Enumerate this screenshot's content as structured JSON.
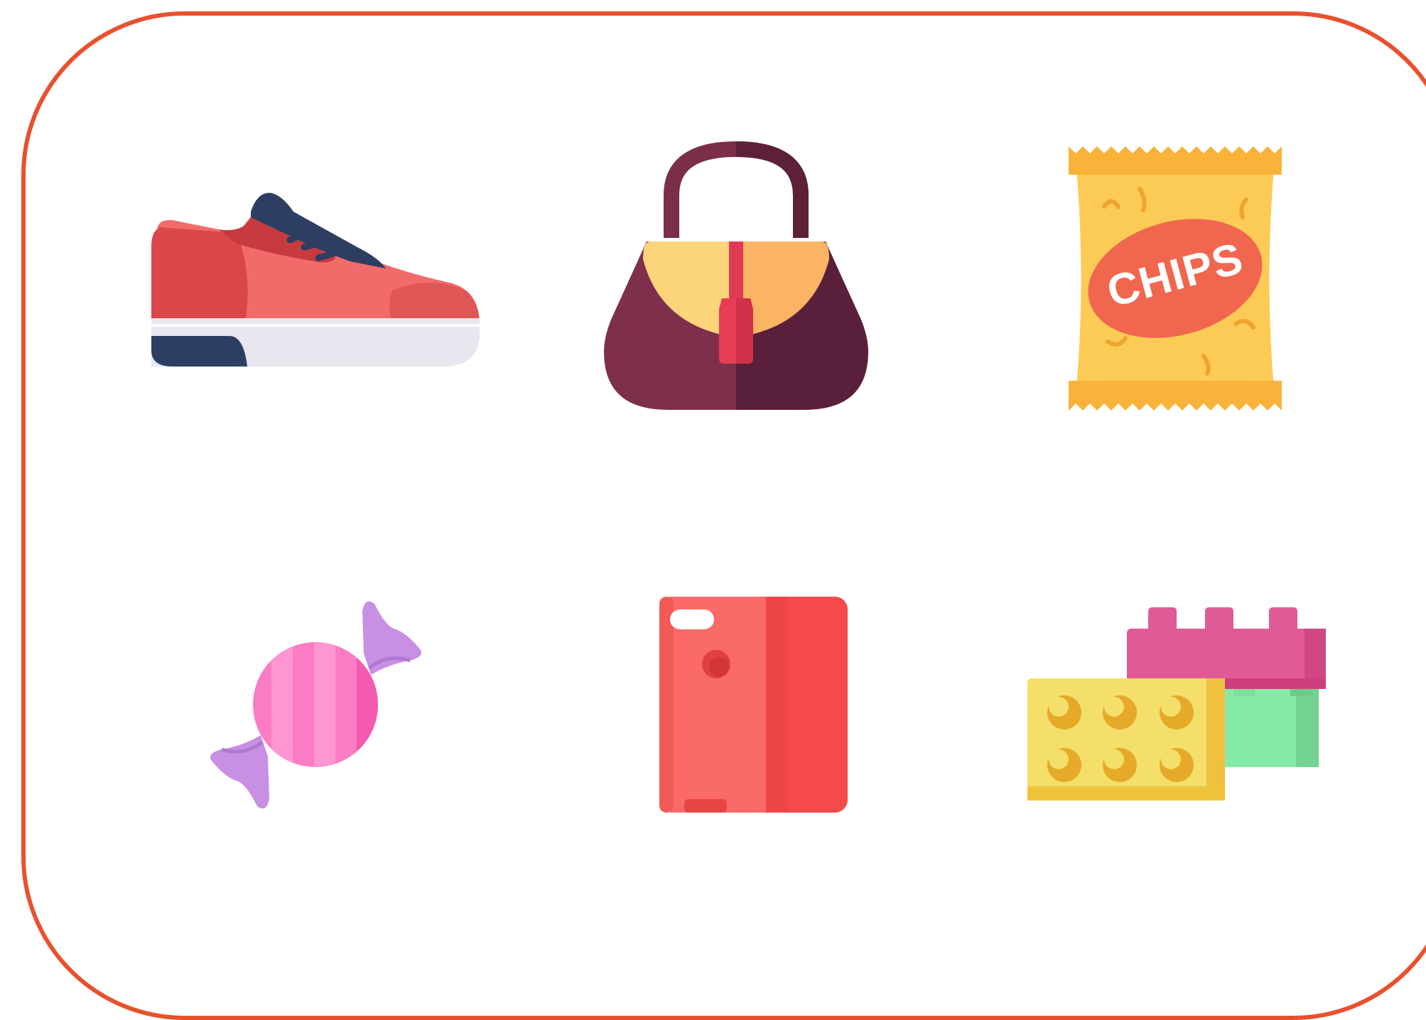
{
  "frame": {
    "border_color": "#E9512E"
  },
  "items": [
    {
      "icon": "sneaker-icon"
    },
    {
      "icon": "handbag-icon"
    },
    {
      "icon": "chips-bag-icon",
      "label": "CHIPS"
    },
    {
      "icon": "candy-icon"
    },
    {
      "icon": "phone-case-icon"
    },
    {
      "icon": "toy-bricks-icon"
    }
  ]
}
